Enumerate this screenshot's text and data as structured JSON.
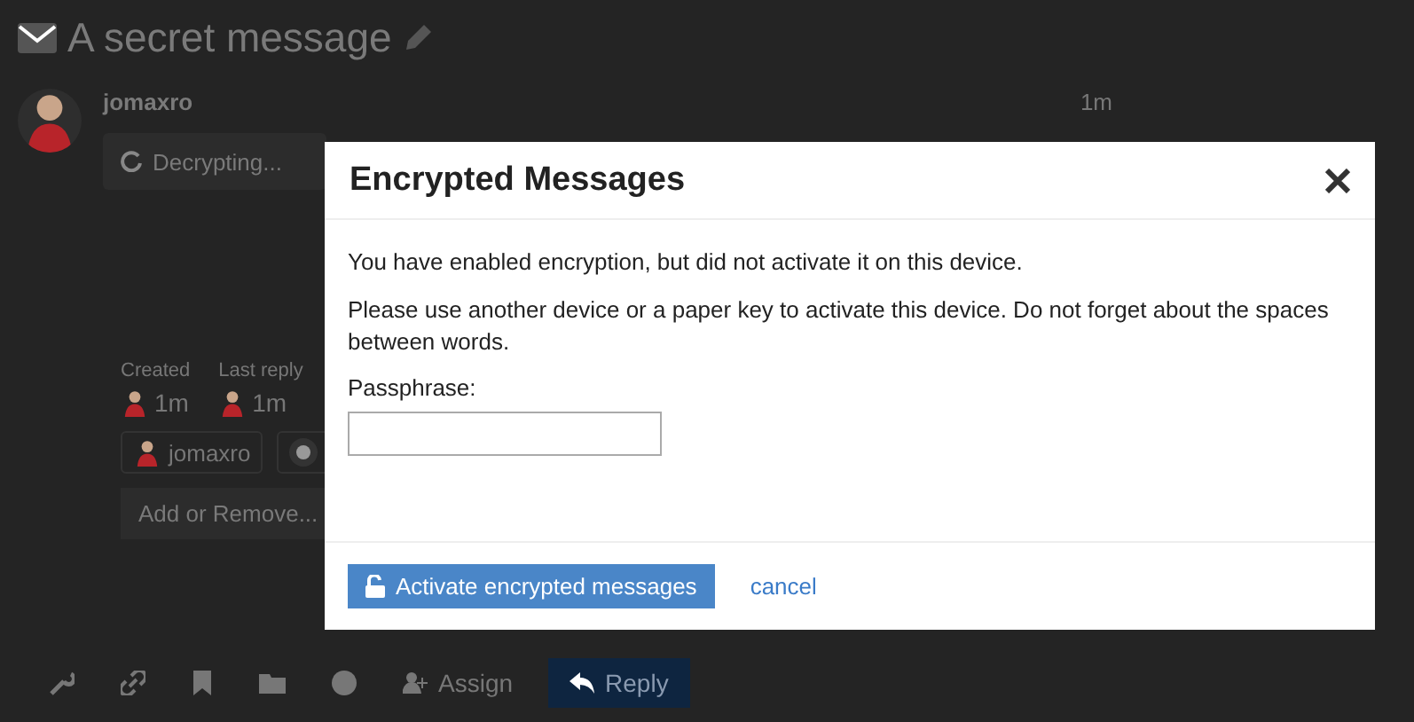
{
  "topic": {
    "title": "A secret message"
  },
  "post": {
    "username": "jomaxro",
    "age": "1m",
    "status": "Decrypting..."
  },
  "topic_map": {
    "stats": [
      {
        "label": "Created",
        "age": "1m"
      },
      {
        "label": "Last reply",
        "age": "1m"
      }
    ],
    "participants": [
      {
        "kind": "person",
        "name": "jomaxro"
      },
      {
        "kind": "round"
      }
    ],
    "add_button": "Add or Remove..."
  },
  "toolbar": {
    "assign": "Assign",
    "reply": "Reply"
  },
  "modal": {
    "title": "Encrypted Messages",
    "paragraphs": [
      "You have enabled encryption, but did not activate it on this device.",
      "Please use another device or a paper key to activate this device. Do not forget about the spaces between words."
    ],
    "field_label": "Passphrase:",
    "primary_button": "Activate encrypted messages",
    "cancel_link": "cancel"
  }
}
